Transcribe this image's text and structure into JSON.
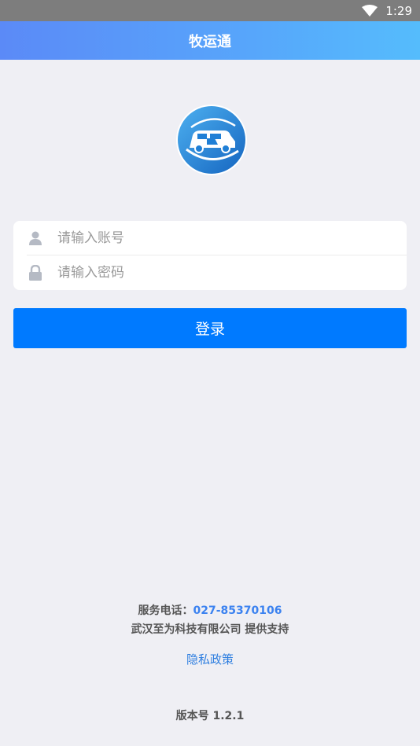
{
  "status_bar": {
    "time": "1:29",
    "wifi_icon": "wifi-icon"
  },
  "header": {
    "title": "牧运通"
  },
  "logo": {
    "icon": "app-logo-vehicle-icon",
    "colors": {
      "primary": "#1f7fd6",
      "light": "#4db0f0",
      "ring": "#ffffff"
    }
  },
  "login_form": {
    "account": {
      "placeholder": "请输入账号",
      "value": "",
      "icon": "user-icon"
    },
    "password": {
      "placeholder": "请输入密码",
      "value": "",
      "icon": "lock-icon"
    }
  },
  "login_button": {
    "label": "登录",
    "color": "#007aff"
  },
  "footer": {
    "phone_label": "服务电话：",
    "phone_number": "027-85370106",
    "company": "武汉至为科技有限公司 提供支持",
    "privacy_link": "隐私政策",
    "version": "版本号 1.2.1"
  }
}
